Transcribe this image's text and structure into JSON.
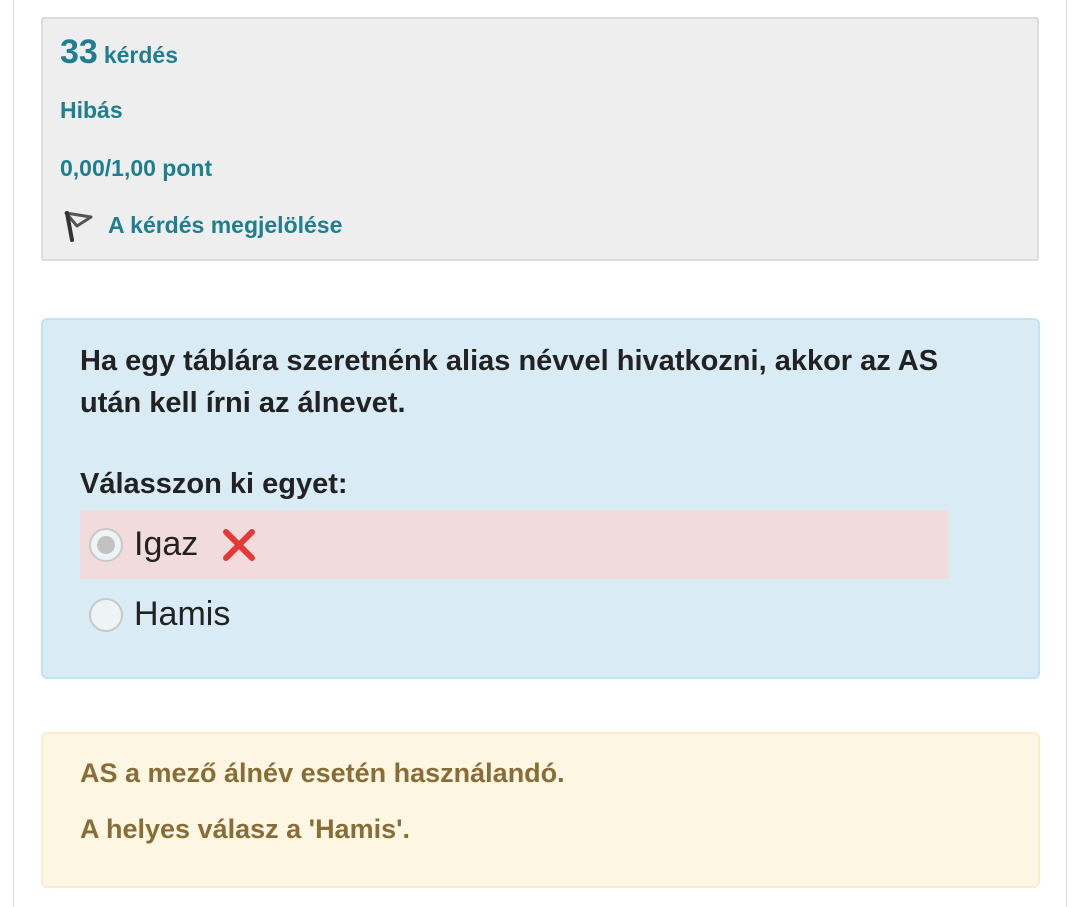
{
  "info": {
    "question_number": "33",
    "question_word": "kérdés",
    "state": "Hibás",
    "grade": "0,00/1,00 pont",
    "flag_label": "A kérdés megjelölése",
    "flag_icon": "flag-icon"
  },
  "question": {
    "text": "Ha egy táblára szeretnénk alias névvel hivatkozni, akkor az AS után kell írni az álnevet.",
    "prompt": "Válasszon ki egyet:",
    "answers": [
      {
        "label": "Igaz",
        "selected": true,
        "status": "incorrect",
        "status_icon": "cross-icon"
      },
      {
        "label": "Hamis",
        "selected": false
      }
    ]
  },
  "feedback": {
    "general": "AS a mező álnév esetén használandó.",
    "right_answer": "A helyes válasz a 'Hamis'."
  },
  "colors": {
    "accent": "#1f7e8f",
    "incorrect_bg": "#f1dbdd",
    "question_bg": "#d9ecf5",
    "feedback_bg": "#fcf6e3",
    "feedback_text": "#8a6d36",
    "cross": "#e53935"
  }
}
